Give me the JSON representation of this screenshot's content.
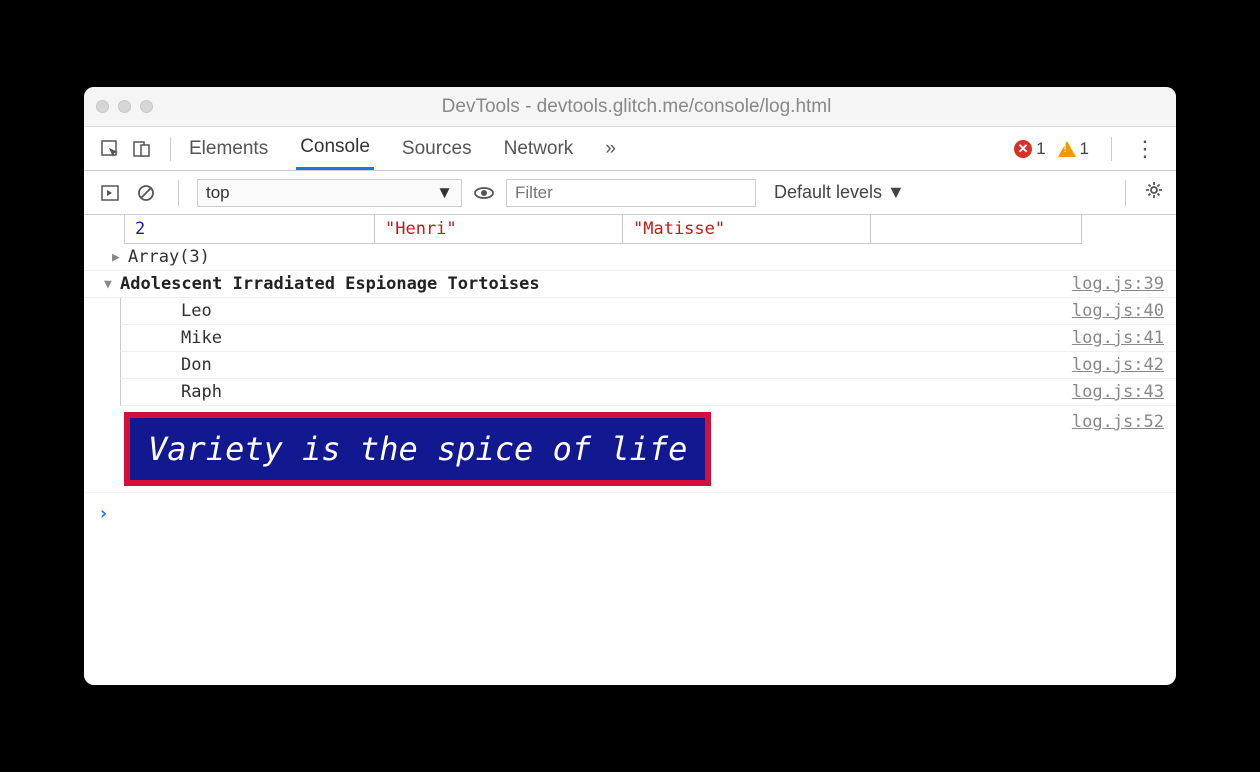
{
  "window": {
    "title": "DevTools - devtools.glitch.me/console/log.html"
  },
  "tabs": {
    "items": [
      "Elements",
      "Console",
      "Sources",
      "Network"
    ],
    "active": "Console",
    "overflow": "»"
  },
  "badges": {
    "error_count": "1",
    "warning_count": "1"
  },
  "filter_bar": {
    "context": "top",
    "filter_placeholder": "Filter",
    "levels": "Default levels ▼"
  },
  "console_output": {
    "table_row": {
      "index": "2",
      "first": "\"Henri\"",
      "last": "\"Matisse\""
    },
    "array_line": "Array(3)",
    "group": {
      "title": "Adolescent Irradiated Espionage Tortoises",
      "src": "log.js:39",
      "items": [
        {
          "text": "Leo",
          "src": "log.js:40"
        },
        {
          "text": "Mike",
          "src": "log.js:41"
        },
        {
          "text": "Don",
          "src": "log.js:42"
        },
        {
          "text": "Raph",
          "src": "log.js:43"
        }
      ]
    },
    "styled": {
      "text": "Variety is the spice of life",
      "src": "log.js:52"
    }
  }
}
